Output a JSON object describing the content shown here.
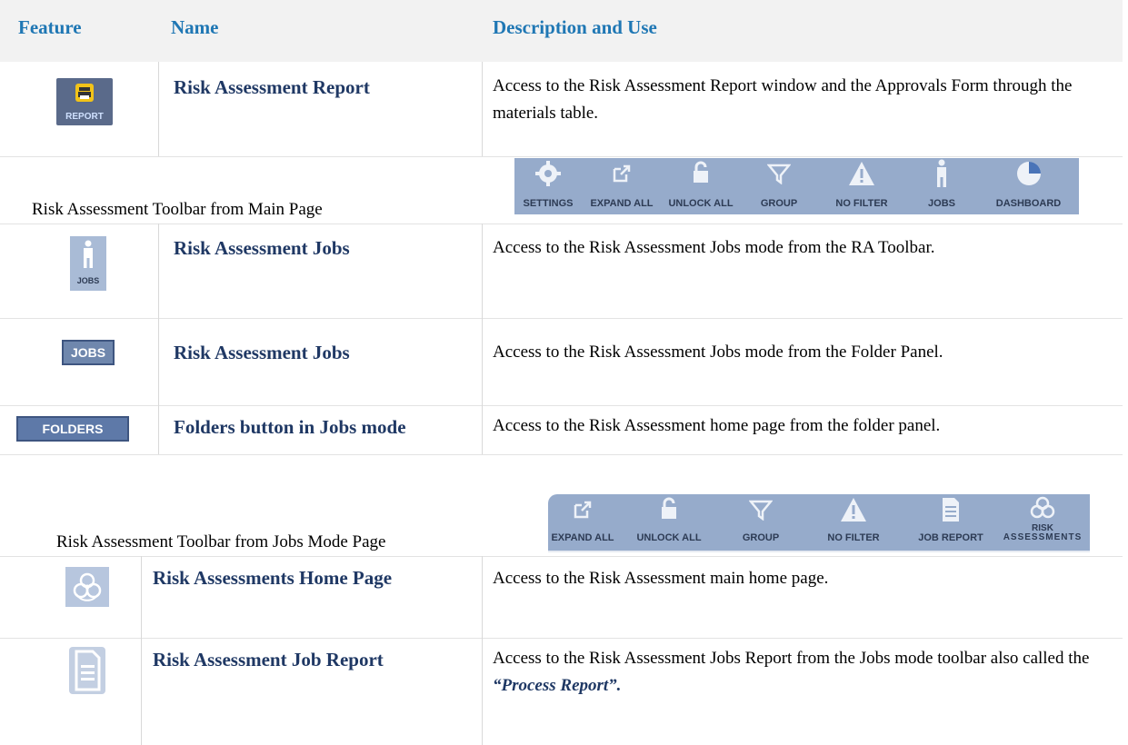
{
  "header": {
    "feature": "Feature",
    "name": "Name",
    "description": "Description and Use"
  },
  "rows": [
    {
      "icon": "report-printer-icon",
      "icon_label": "REPORT",
      "name": "Risk Assessment Report",
      "description": "Access to the Risk Assessment Report window and the Approvals Form through the materials table."
    },
    {
      "full_label": "Risk Assessment Toolbar from Main Page"
    },
    {
      "icon": "jobs-person-icon",
      "icon_label": "JOBS",
      "name": "Risk Assessment Jobs",
      "description": "Access to the Risk Assessment Jobs mode from the RA Toolbar."
    },
    {
      "icon": "jobs-button-icon",
      "icon_label": "JOBS",
      "name": "Risk Assessment Jobs",
      "description": "Access to the Risk Assessment Jobs mode from the Folder Panel."
    },
    {
      "icon": "folders-button-icon",
      "icon_label": "FOLDERS",
      "name": "Folders button in Jobs mode",
      "description": "Access to the Risk Assessment home page from the folder panel."
    },
    {
      "full_label": "Risk Assessment Toolbar from Jobs Mode Page"
    },
    {
      "icon": "biohazard-icon",
      "name": "Risk Assessments Home Page",
      "description": "Access to the Risk Assessment main home page."
    },
    {
      "icon": "document-icon",
      "name": "Risk Assessment Job Report",
      "description": "Access to the Risk Assessment Jobs Report from the Jobs mode toolbar also called the ",
      "description_emphasis": "“Process Report”."
    }
  ],
  "toolbar_main": [
    "SETTINGS",
    "EXPAND ALL",
    "UNLOCK ALL",
    "GROUP",
    "NO FILTER",
    "JOBS",
    "DASHBOARD"
  ],
  "toolbar_jobs": [
    "EXPAND ALL",
    "UNLOCK ALL",
    "GROUP",
    "NO FILTER",
    "JOB REPORT",
    "RISK",
    "ASSESSMENTS"
  ],
  "colors": {
    "header_text": "#1f77b4",
    "name_text": "#1f3864",
    "toolbar_bg": "#96abcb",
    "header_bg": "#f2f2f2"
  }
}
